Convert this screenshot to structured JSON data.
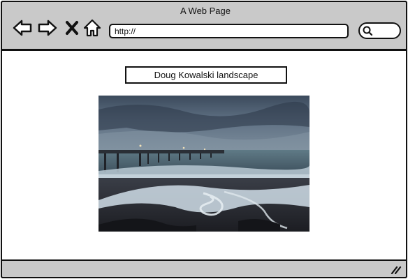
{
  "window": {
    "title": "A Web Page"
  },
  "toolbar": {
    "back_icon": "back-arrow-icon",
    "forward_icon": "forward-arrow-icon",
    "stop_icon": "close-icon",
    "home_icon": "home-icon",
    "url_value": "http://",
    "search_icon": "search-icon"
  },
  "content": {
    "heading": "Doug Kowalski landscape",
    "image_subject": "long-exposure seascape with pier at dusk"
  },
  "colors": {
    "chrome": "#c9c9c9",
    "outline": "#111111",
    "page": "#ffffff"
  }
}
